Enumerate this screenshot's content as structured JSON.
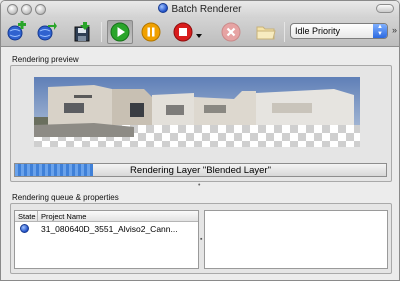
{
  "window": {
    "title": "Batch Renderer"
  },
  "toolbar": {
    "priority_selected": "Idle Priority",
    "overflow_glyph": "»"
  },
  "preview": {
    "section_label": "Rendering preview"
  },
  "progress": {
    "label": "Rendering Layer \"Blended Layer\"",
    "fraction": 0.21
  },
  "queue": {
    "section_label": "Rendering queue & properties",
    "columns": [
      "State",
      "Project Name"
    ],
    "rows": [
      {
        "project_name": "31_080640D_3551_Alviso2_Cann..."
      }
    ]
  },
  "colors": {
    "accent_blue": "#3f80d8",
    "play_green": "#2aa52a",
    "pause_orange": "#f0a000",
    "stop_red": "#d81d1d"
  }
}
